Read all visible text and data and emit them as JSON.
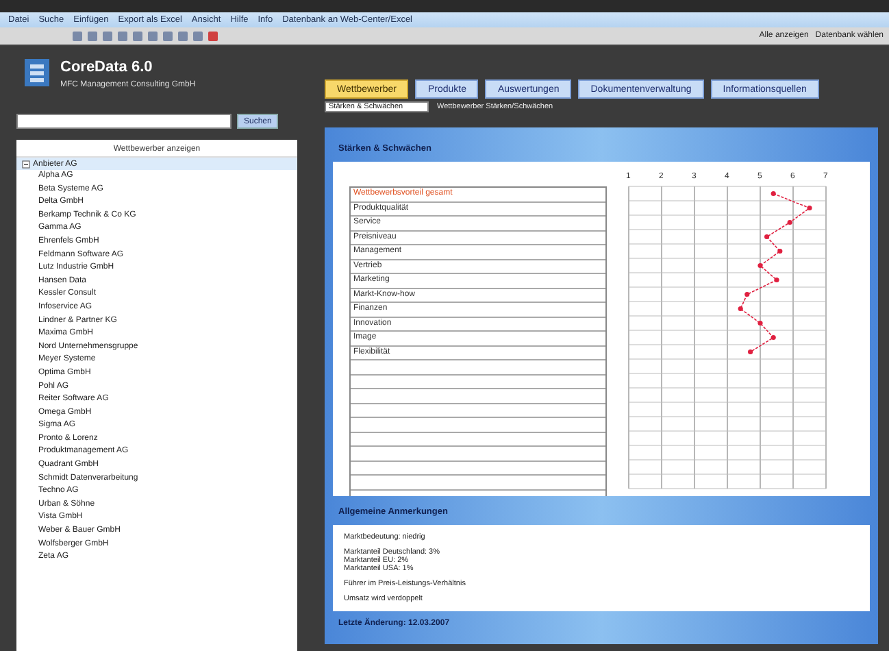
{
  "menu": [
    "Datei",
    "Suche",
    "Einfügen",
    "Export als Excel",
    "Ansicht",
    "Hilfe",
    "Info",
    "Datenbank an Web-Center/Excel"
  ],
  "toolbar": {
    "right_labels": [
      "Alle anzeigen",
      "Datenbank wählen"
    ]
  },
  "header": {
    "title": "CoreData 6.0",
    "subtitle": "MFC Management Consulting GmbH",
    "search_button": "Suchen"
  },
  "tabs": [
    {
      "label": "Wettbewerber",
      "selected": true
    },
    {
      "label": "Produkte",
      "selected": false
    },
    {
      "label": "Auswertungen",
      "selected": false
    },
    {
      "label": "Dokumentenverwaltung",
      "selected": false
    },
    {
      "label": "Informationsquellen",
      "selected": false
    }
  ],
  "view_select": {
    "value": "Stärken & Schwächen"
  },
  "view_caption": "Wettbewerber Stärken/Schwächen",
  "sidebar": {
    "header": "Wettbewerber anzeigen",
    "root": "Anbieter AG",
    "expanded": true,
    "items": [
      "Alpha AG",
      "Beta Systeme AG",
      "Delta GmbH",
      "Berkamp Technik & Co KG",
      "Gamma AG",
      "Ehrenfels GmbH",
      "Feldmann Software AG",
      "Lutz Industrie GmbH",
      "Hansen Data",
      "Kessler Consult",
      "Infoservice AG",
      "Lindner & Partner KG",
      "Maxima GmbH",
      "Nord Unternehmensgruppe",
      "Meyer Systeme",
      "Optima GmbH",
      "Pohl AG",
      "Reiter Software AG",
      "Omega GmbH",
      "Sigma AG",
      "Pronto & Lorenz",
      "Produktmanagement AG",
      "Quadrant GmbH",
      "Schmidt Datenverarbeitung",
      "Techno AG",
      "Urban & Söhne",
      "Vista GmbH",
      "Weber & Bauer GmbH",
      "Wolfsberger GmbH",
      "Zeta AG"
    ]
  },
  "profile": {
    "title": "Stärken & Schwächen",
    "rows": [
      {
        "label": "Wettbewerbsvorteil gesamt",
        "kind": "highlight"
      },
      {
        "label": "Produktqualität",
        "kind": "normal"
      },
      {
        "label": "Service",
        "kind": "normal"
      },
      {
        "label": "Preisniveau",
        "kind": "normal"
      },
      {
        "label": "Management",
        "kind": "normal"
      },
      {
        "label": "Vertrieb",
        "kind": "normal"
      },
      {
        "label": "Marketing",
        "kind": "normal"
      },
      {
        "label": "Markt-Know-how",
        "kind": "normal"
      },
      {
        "label": "Finanzen",
        "kind": "normal"
      },
      {
        "label": "Innovation",
        "kind": "normal"
      },
      {
        "label": "Image",
        "kind": "normal"
      },
      {
        "label": "Flexibilität",
        "kind": "normal"
      }
    ],
    "chart_data": {
      "type": "line",
      "orientation": "horizontal",
      "grid": true,
      "xlim": [
        1,
        7
      ],
      "xticks": [
        1,
        2,
        3,
        4,
        5,
        6,
        7
      ],
      "series": [
        {
          "color": "#e02040",
          "line_style": "dashed",
          "marker": "circle",
          "values": [
            5.4,
            6.5,
            5.9,
            5.2,
            5.6,
            5.0,
            5.5,
            4.6,
            4.4,
            5.0,
            5.4,
            4.7
          ]
        }
      ]
    }
  },
  "notes": {
    "title": "Allgemeine Anmerkungen",
    "paragraphs": [
      [
        "Marktbedeutung: niedrig"
      ],
      [
        "Marktanteil Deutschland: 3%",
        "Marktanteil EU: 2%",
        "Marktanteil USA: 1%"
      ],
      [
        "Führer im Preis-Leistungs-Verhältnis"
      ],
      [
        "Umsatz wird verdoppelt"
      ]
    ]
  },
  "footer": "Letzte Änderung: 12.03.2007"
}
